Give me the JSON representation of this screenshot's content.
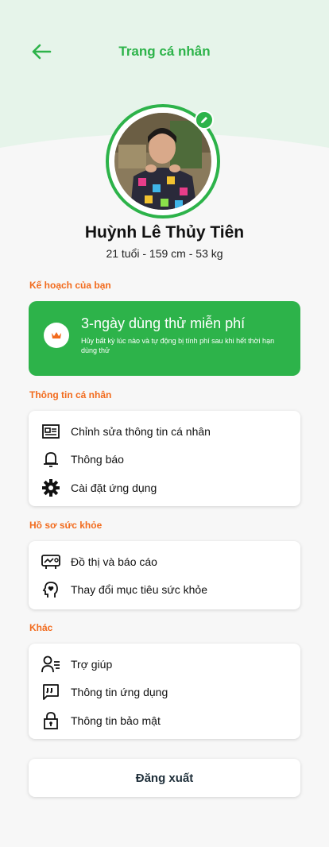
{
  "header": {
    "title": "Trang cá nhân",
    "back_icon": "arrow-left-icon",
    "accent": "#2db34a",
    "bg": "#e6f4ea"
  },
  "profile": {
    "name": "Huỳnh Lê Thủy Tiên",
    "stats": "21 tuổi - 159 cm - 53 kg",
    "edit_icon": "pencil-icon"
  },
  "plan": {
    "section": "Kế hoạch của bạn",
    "title": "3-ngày dùng thử miễn phí",
    "description": "Hủy bất kỳ lúc nào và tự động bị tính phí sau khi hết thời hạn dùng thử",
    "icon": "crown-icon"
  },
  "personal": {
    "section": "Thông tin cá nhân",
    "items": [
      {
        "label": "Chỉnh sửa thông tin cá nhân",
        "icon": "id-card-icon"
      },
      {
        "label": "Thông báo",
        "icon": "bell-icon"
      },
      {
        "label": "Cài đặt ứng dụng",
        "icon": "gear-icon"
      }
    ]
  },
  "health": {
    "section": "Hồ sơ sức khỏe",
    "items": [
      {
        "label": "Đồ thị và báo cáo",
        "icon": "chart-report-icon"
      },
      {
        "label": "Thay đổi mục tiêu sức khỏe",
        "icon": "head-heart-icon"
      }
    ]
  },
  "other": {
    "section": "Khác",
    "items": [
      {
        "label": "Trợ giúp",
        "icon": "help-person-icon"
      },
      {
        "label": "Thông tin ứng dụng",
        "icon": "quote-icon"
      },
      {
        "label": "Thông tin bảo mật",
        "icon": "lock-icon"
      }
    ]
  },
  "logout_label": "Đăng xuất",
  "colors": {
    "accent": "#2db34a",
    "section": "#f26b1d"
  }
}
